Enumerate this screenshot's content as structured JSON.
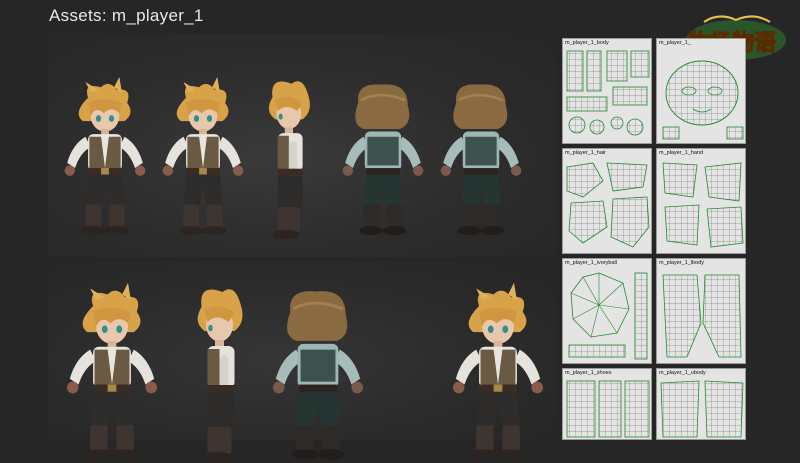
{
  "header": {
    "title": "Assets: m_player_1"
  },
  "logo": {
    "text": "牧场物语"
  },
  "uv_maps": [
    {
      "label": "m_player_1_body"
    },
    {
      "label": "m_player_1_"
    },
    {
      "label": "m_player_1_hair"
    },
    {
      "label": "m_player_1_hand"
    },
    {
      "label": "m_player_1_ivoryball"
    },
    {
      "label": "m_player_1_lbody"
    },
    {
      "label": "m_player_1_shoes"
    },
    {
      "label": "m_player_1_ubody"
    }
  ],
  "colors": {
    "background": "#262626",
    "uv_wire": "#1f8a2a",
    "uv_bg": "#e4e4e4",
    "hair": "#d9a54a",
    "logo_orange": "#f28a1a"
  }
}
